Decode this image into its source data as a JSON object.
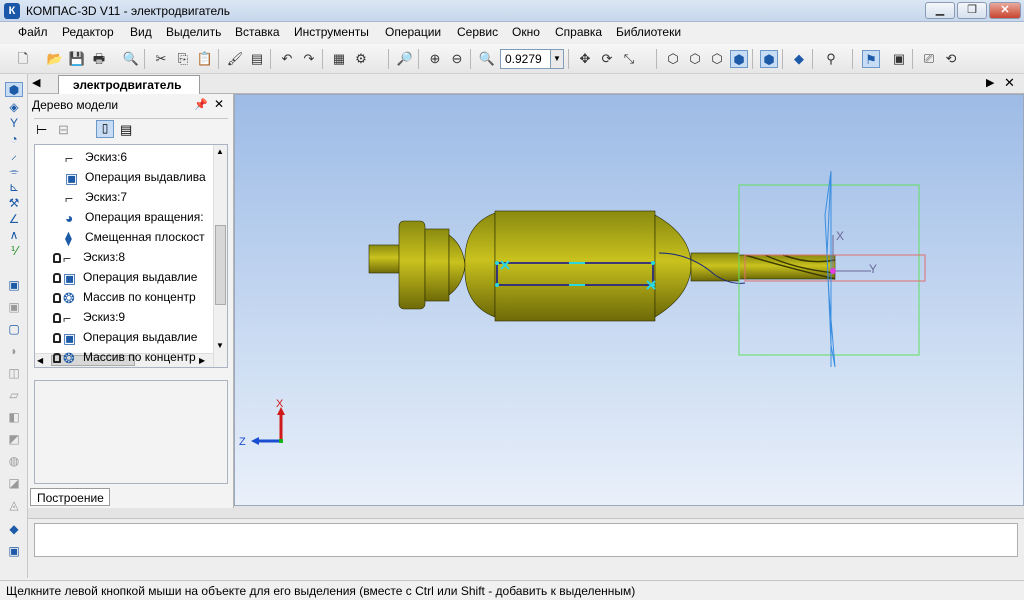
{
  "window": {
    "title": "КОМПАС-3D V11 - электродвигатель",
    "app_icon": "К",
    "minimize": "▁",
    "maximize": "❐",
    "close": "✕"
  },
  "menu": {
    "items": [
      "Файл",
      "Редактор",
      "Вид",
      "Выделить",
      "Вставка",
      "Инструменты",
      "Операции",
      "Сервис",
      "Окно",
      "Справка",
      "Библиотеки"
    ]
  },
  "toolbar": {
    "zoom_value": "0.9279"
  },
  "document": {
    "tab_label": "электродвигатель"
  },
  "model_tree": {
    "header": "Дерево модели",
    "items": [
      {
        "label": "Эскиз:6",
        "icon": "sketch-icon",
        "locked": false
      },
      {
        "label": "Операция выдавлива",
        "icon": "extrude-icon",
        "locked": false
      },
      {
        "label": "Эскиз:7",
        "icon": "sketch-icon",
        "locked": false
      },
      {
        "label": "Операция вращения:",
        "icon": "revolve-icon",
        "locked": false
      },
      {
        "label": "Смещенная плоскост",
        "icon": "plane-icon",
        "locked": false
      },
      {
        "label": "Эскиз:8",
        "icon": "sketch-icon",
        "locked": true
      },
      {
        "label": "Операция выдавлие",
        "icon": "extrude-icon",
        "locked": true
      },
      {
        "label": "Массив по концентр",
        "icon": "array-icon",
        "locked": true
      },
      {
        "label": "Эскиз:9",
        "icon": "sketch-icon",
        "locked": true
      },
      {
        "label": "Операция выдавлие",
        "icon": "extrude-icon",
        "locked": true
      },
      {
        "label": "Массив по концентр",
        "icon": "array-icon",
        "locked": true
      }
    ],
    "bottom_tab": "Построение"
  },
  "viewport": {
    "axis_x": "X",
    "axis_y": "Y",
    "axis_z": "Z"
  },
  "status": {
    "text": "Щелкните левой кнопкой мыши на объекте для его выделения (вместе с Ctrl или Shift - добавить к выделенным)"
  }
}
